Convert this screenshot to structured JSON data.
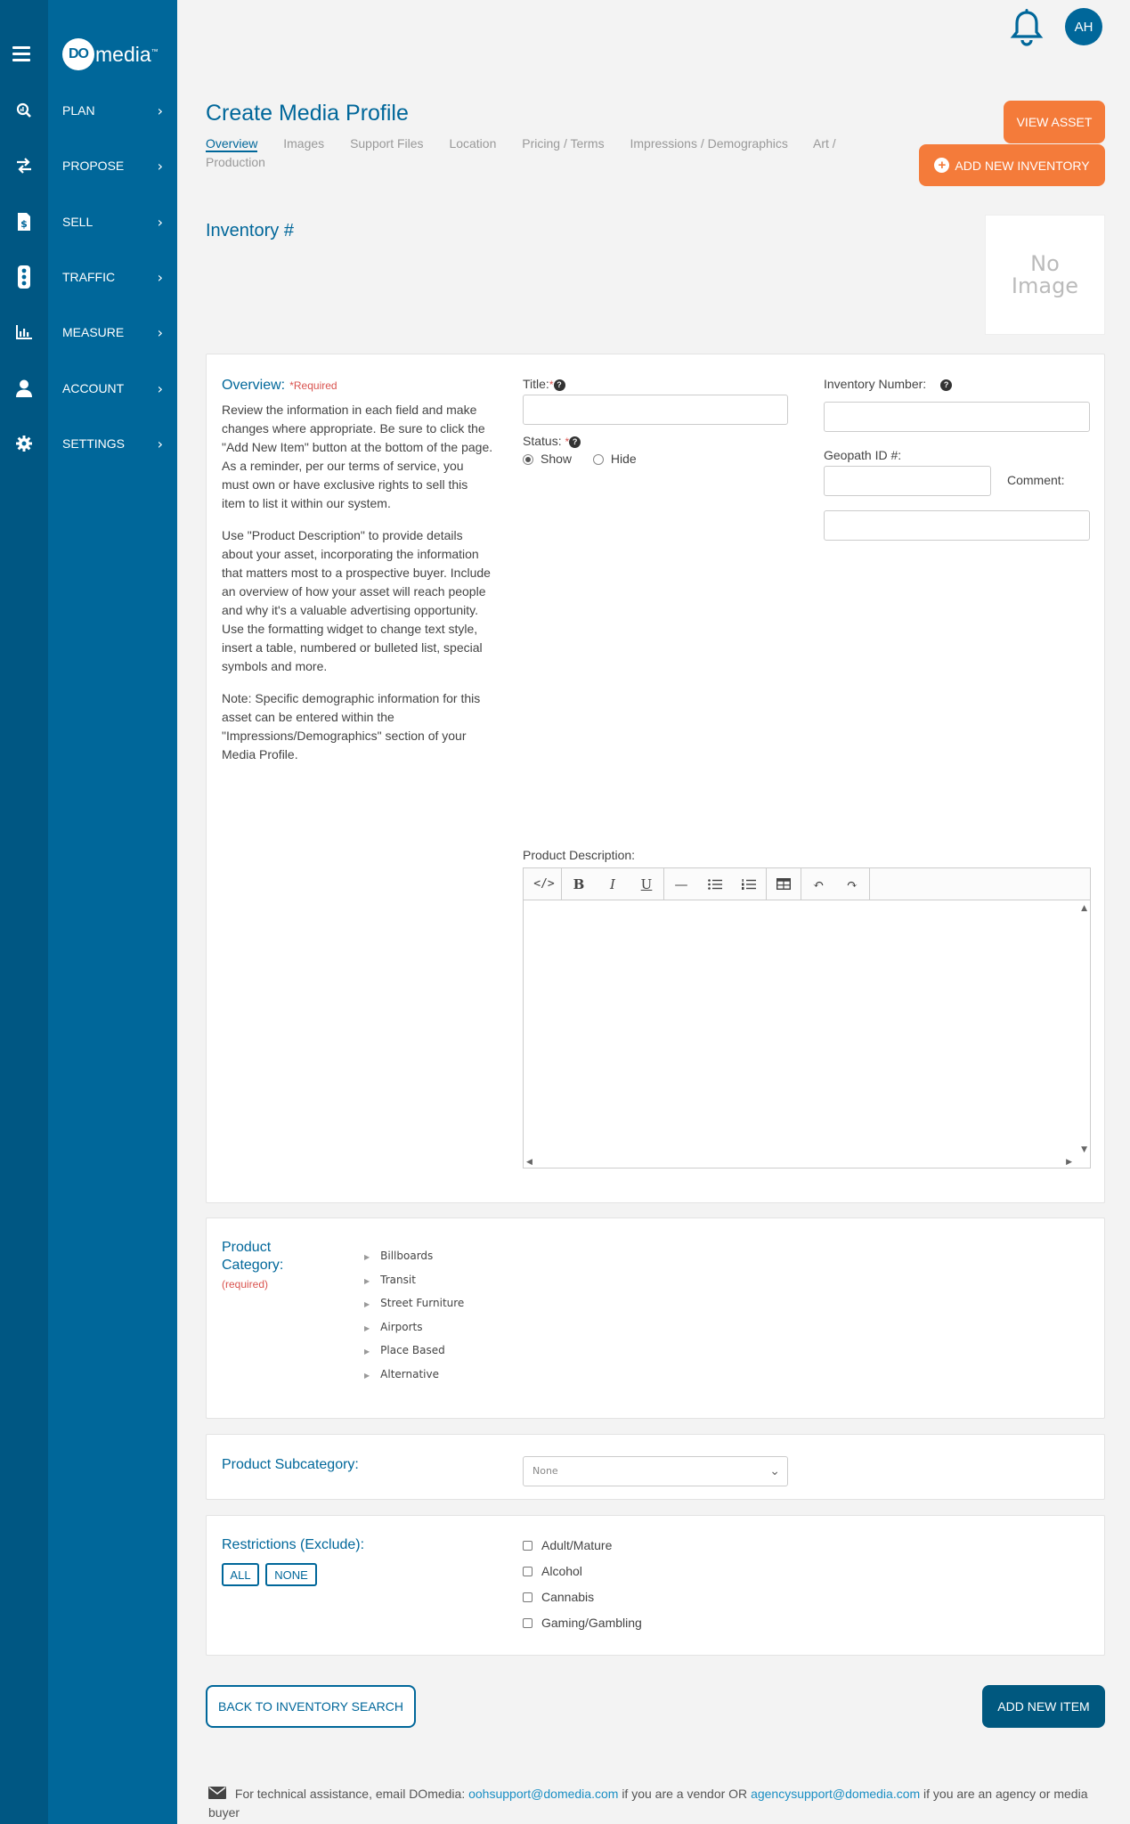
{
  "sidebar": {
    "logo": {
      "badge": "DO",
      "text": "media",
      "mark": "™"
    },
    "items": [
      {
        "label": "PLAN",
        "icon": "search-chart-icon"
      },
      {
        "label": "PROPOSE",
        "icon": "arrows-exchange-icon"
      },
      {
        "label": "SELL",
        "icon": "invoice-dollar-icon"
      },
      {
        "label": "TRAFFIC",
        "icon": "traffic-light-icon"
      },
      {
        "label": "MEASURE",
        "icon": "bar-chart-icon"
      },
      {
        "label": "ACCOUNT",
        "icon": "user-icon"
      },
      {
        "label": "SETTINGS",
        "icon": "gear-icon"
      }
    ]
  },
  "header": {
    "avatar": "AH",
    "bell_icon": "bell-icon"
  },
  "page": {
    "title": "Create Media Profile",
    "tabs": [
      "Overview",
      "Images",
      "Support Files",
      "Location",
      "Pricing / Terms",
      "Impressions / Demographics",
      "Art / Production"
    ],
    "view_asset": "VIEW ASSET",
    "add_new_inventory": "ADD NEW INVENTORY",
    "inventory_heading": "Inventory #",
    "no_image": "No Image"
  },
  "overview": {
    "title": "Overview:",
    "required": "*Required",
    "paragraphs": [
      "Review the information in each field and make changes where appropriate. Be sure to click the \"Add New Item\" button at the bottom of the page. As a reminder, per our terms of service, you must own or have exclusive rights to sell this item to list it within our system.",
      "Use \"Product Description\" to provide details about your asset, incorporating the information that matters most to a prospective buyer. Include an overview of how your asset will reach people and why it's a valuable advertising opportunity. Use the formatting widget to change text style, insert a table, numbered or bulleted list, special symbols and more.",
      "Note: Specific demographic information for this asset can be entered within the \"Impressions/Demographics\" section of your Media Profile."
    ],
    "title_label": "Title:",
    "title_req": "*",
    "title_value": "",
    "status_label": "Status:",
    "status_req": "*",
    "status_show": "Show",
    "status_hide": "Hide",
    "inventory_number_label": "Inventory Number:",
    "inventory_number_value": "",
    "geopath_label": "Geopath ID #:",
    "geopath_value": "",
    "comment_label": "Comment:",
    "comment_value": "",
    "product_description_label": "Product Description:",
    "editor_value": ""
  },
  "category": {
    "title_line1": "Product",
    "title_line2": "Category:",
    "required": "(required)",
    "items": [
      "Billboards",
      "Transit",
      "Street Furniture",
      "Airports",
      "Place Based",
      "Alternative"
    ]
  },
  "subcategory": {
    "title": "Product Subcategory:",
    "selected": "None"
  },
  "restrictions": {
    "title": "Restrictions (Exclude):",
    "all": "ALL",
    "none": "NONE",
    "options": [
      "Adult/Mature",
      "Alcohol",
      "Cannabis",
      "Gaming/Gambling"
    ]
  },
  "actions": {
    "back": "BACK TO INVENTORY SEARCH",
    "add": "ADD NEW ITEM"
  },
  "footer": {
    "text1": "For technical assistance, email DOmedia:",
    "email1": "oohsupport@domedia.com",
    "text2": "if you are a vendor OR",
    "email2": "agencysupport@domedia.com",
    "text3": "if you are an agency or media buyer"
  },
  "colors": {
    "sidebar": "#00679a",
    "sidebar_strip": "#005783",
    "accent_orange": "#f47b3a",
    "primary": "#00679a",
    "required_red": "#d9534f"
  }
}
